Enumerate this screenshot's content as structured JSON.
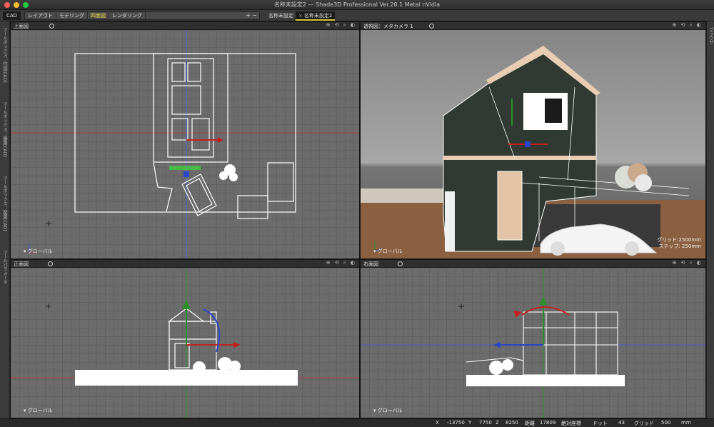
{
  "window": {
    "title": "名称未設定2 — Shade3D Professional Ver.20.1 Metal nVidia"
  },
  "toolbar": {
    "cad_tab": "CAD",
    "modes": [
      "レイアウト",
      "モデリング",
      "四面図",
      "レンダリング"
    ],
    "active_mode": "四面図",
    "plus_minus": "+ −"
  },
  "documents": {
    "tabs": [
      {
        "label": "名称未設定",
        "close": ""
      },
      {
        "label": "名称未設定2",
        "close": "×"
      }
    ]
  },
  "left_panel": {
    "labels": [
      "ツールボックス：作成[CAD]",
      "ツールボックス：編集[CAD]",
      "ツールボックス：配置[CAD]",
      "ツールパラメータ"
    ]
  },
  "right_panel": {
    "label": "ブラウザ"
  },
  "viewports": {
    "top": {
      "name": "上面図",
      "coord_label": "グローバル",
      "tools": "⊕ ⟲ ⌕ ◐"
    },
    "perspective": {
      "name": "透視図：メタカメラ 1",
      "coord_label": "グローバル",
      "tools": "⊕ ⟲ ⌕ ◐",
      "grid_text": "グリッド:2500mm",
      "step_text": "ステップ: 250mm"
    },
    "front": {
      "name": "正面図",
      "coord_label": "グローバル",
      "tools": "⊕ ⟲ ⌕ ◐"
    },
    "right": {
      "name": "右面図",
      "coord_label": "グローバル",
      "tools": "⊕ ⟲ ⌕ ◐"
    }
  },
  "statusbar": {
    "x_label": "X",
    "x_value": "-13750",
    "y_label": "Y",
    "y_value": "7750",
    "z_label": "Z",
    "z_value": "8250",
    "dist_label": "距離",
    "dist_value": "17809",
    "coord_mode": "絶対座標",
    "dot_label": "ドット",
    "dot_value": "43",
    "grid_label": "グリッド",
    "grid_value": "500",
    "unit": "mm"
  },
  "colors": {
    "active_mode": "#f3e24e",
    "axis_red": "#c22020",
    "axis_green": "#2f8f2f",
    "axis_blue": "#2a45c8",
    "wire": "#ffffff"
  }
}
